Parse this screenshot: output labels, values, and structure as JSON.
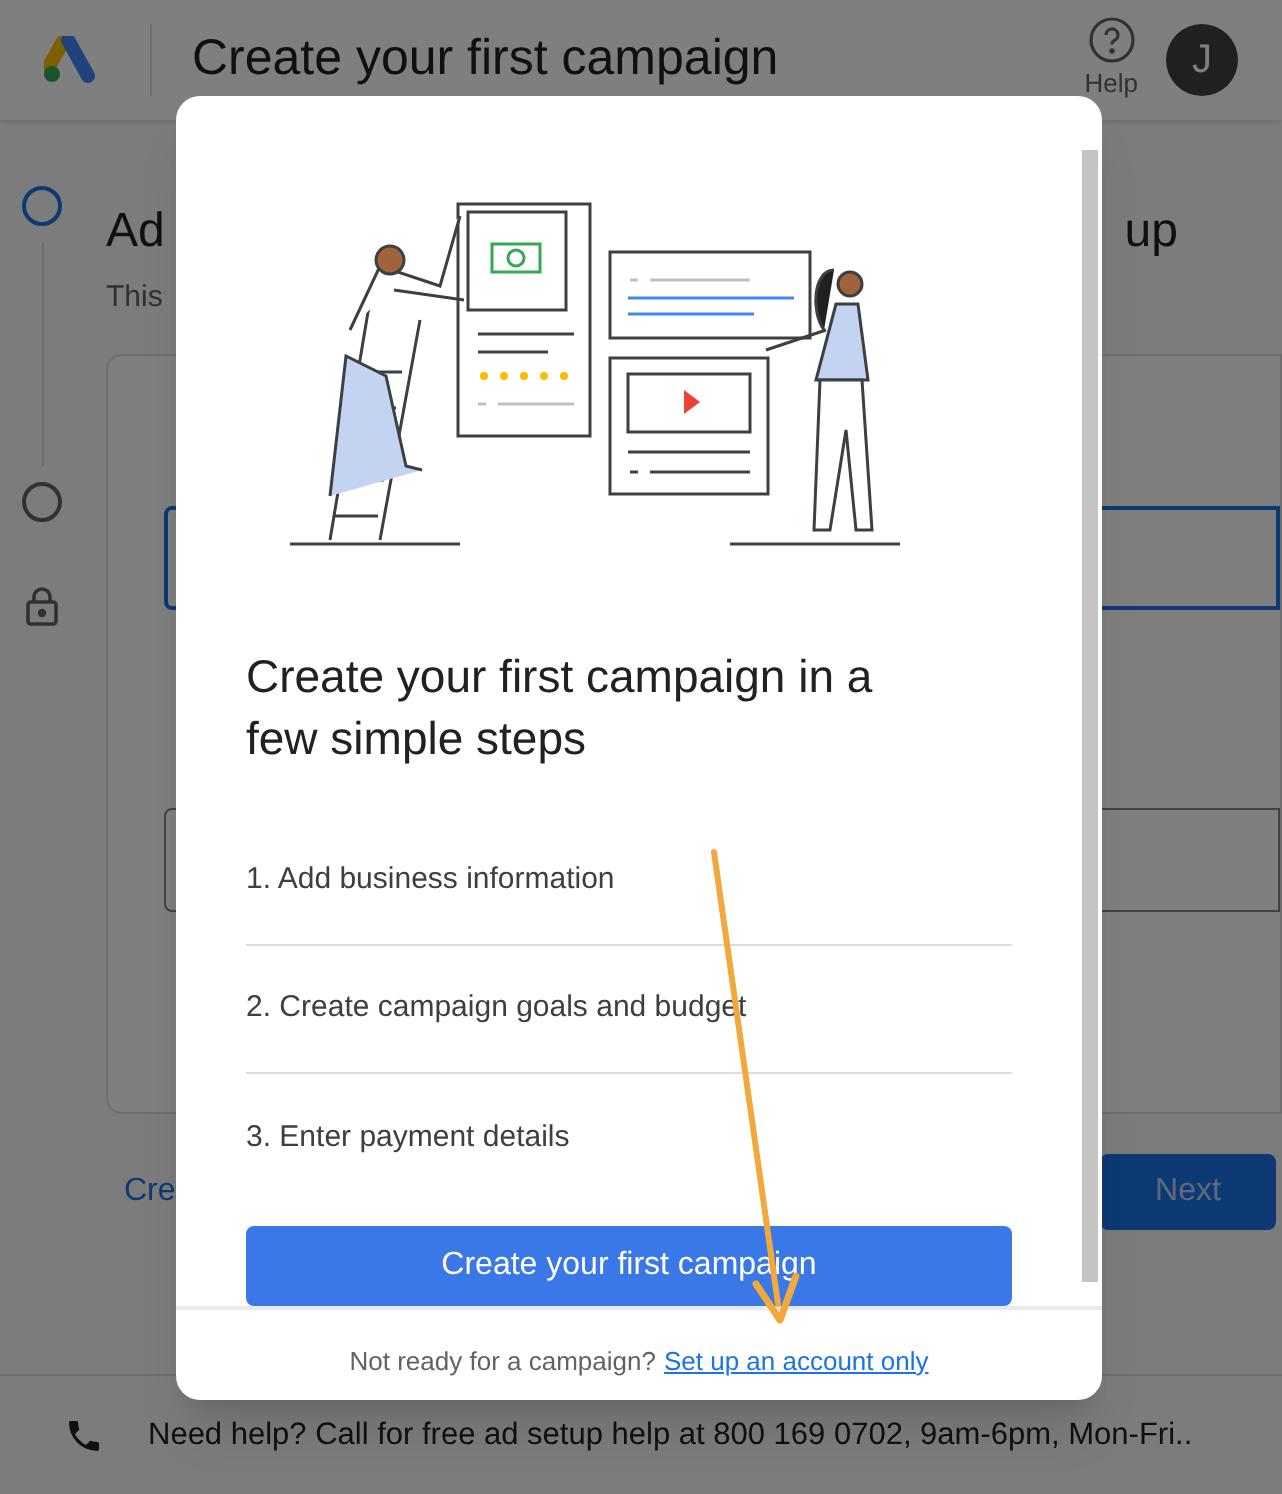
{
  "header": {
    "title": "Create your first campaign",
    "help_label": "Help",
    "avatar_initial": "J"
  },
  "stepper": [
    {
      "kind": "current"
    },
    {
      "kind": "pending"
    },
    {
      "kind": "locked"
    }
  ],
  "background": {
    "title_start": "Ad",
    "title_end": "up",
    "subtitle": "This",
    "fields": [
      {
        "focused": true
      },
      {
        "focused": false
      }
    ],
    "back_link": "Cre",
    "next_button": "Next"
  },
  "footer": {
    "text": "Need help? Call for free ad setup help at 800 169 0702, 9am-6pm, Mon-Fri.."
  },
  "dialog": {
    "heading": "Create your first campaign in a few simple steps",
    "steps": [
      "1. Add business information",
      "2. Create campaign goals and budget",
      "3. Enter payment details"
    ],
    "primary_button": "Create your first campaign",
    "footer_text": "Not ready for a campaign?",
    "footer_link": "Set up an account only"
  }
}
